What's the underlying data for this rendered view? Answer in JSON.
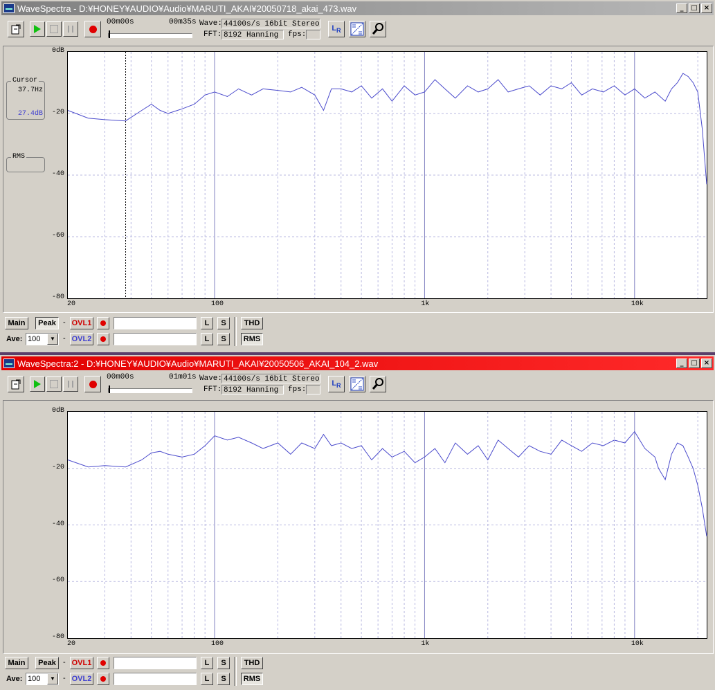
{
  "windows": [
    {
      "title": "WaveSpectra - D:¥HONEY¥AUDIO¥Audio¥MARUTI_AKAI¥20050718_akai_473.wav",
      "active": false,
      "time_start": "00m00s",
      "time_end": "00m35s",
      "position_fraction": 0.0,
      "wave_label": "Wave:",
      "wave_value": "44100s/s 16bit Stereo",
      "fft_label": "FFT:",
      "fft_value": "8192 Hanning",
      "fps_label": "fps:",
      "fps_value": "",
      "cursor_label": "Cursor",
      "cursor_freq": "37.7Hz",
      "cursor_db": "27.4dB",
      "cursor_hz": 37.7,
      "rms_label": "RMS",
      "bottom": {
        "main": "Main",
        "peak": "Peak",
        "ave_label": "Ave:",
        "ave_value": "100",
        "ovl1": "OVL1",
        "ovl2": "OVL2",
        "l": "L",
        "s": "S",
        "thd": "THD",
        "rms": "RMS",
        "dash": "-"
      }
    },
    {
      "title": "WaveSpectra:2 - D:¥HONEY¥AUDIO¥Audio¥MARUTI_AKAI¥20050506_AKAI_104_2.wav",
      "active": true,
      "time_start": "00m00s",
      "time_end": "01m01s",
      "position_fraction": 0.0,
      "wave_label": "Wave:",
      "wave_value": "44100s/s 16bit Stereo",
      "fft_label": "FFT:",
      "fft_value": "8192 Hanning",
      "fps_label": "fps:",
      "fps_value": "",
      "bottom": {
        "main": "Main",
        "peak": "Peak",
        "ave_label": "Ave:",
        "ave_value": "100",
        "ovl1": "OVL1",
        "ovl2": "OVL2",
        "l": "L",
        "s": "S",
        "thd": "THD",
        "rms": "RMS",
        "dash": "-"
      }
    }
  ],
  "colors": {
    "trace": "#4a4acc",
    "grid": "#b8b8e0",
    "title_active": "#e00000",
    "title_inactive": "#9a9a9a"
  },
  "chart_data": [
    {
      "type": "line",
      "xscale": "log",
      "xlim": [
        20,
        22050
      ],
      "ylim": [
        -80,
        0
      ],
      "xticks": [
        {
          "v": 20,
          "label": "20"
        },
        {
          "v": 100,
          "label": "100"
        },
        {
          "v": 1000,
          "label": "1k"
        },
        {
          "v": 10000,
          "label": "10k"
        }
      ],
      "yticks": [
        {
          "v": 0,
          "label": "0dB"
        },
        {
          "v": -20,
          "label": "-20"
        },
        {
          "v": -40,
          "label": "-40"
        },
        {
          "v": -60,
          "label": "-60"
        },
        {
          "v": -80,
          "label": "-80"
        }
      ],
      "grid": true,
      "series": [
        {
          "x": [
            20,
            25,
            30,
            37.7,
            45,
            50,
            55,
            60,
            70,
            80,
            90,
            100,
            115,
            130,
            150,
            170,
            200,
            230,
            260,
            300,
            330,
            360,
            400,
            450,
            500,
            560,
            630,
            700,
            800,
            900,
            1000,
            1120,
            1250,
            1400,
            1600,
            1800,
            2000,
            2240,
            2500,
            2800,
            3150,
            3550,
            4000,
            4500,
            5000,
            5600,
            6300,
            7100,
            8000,
            9000,
            10000,
            11200,
            12500,
            14000,
            15000,
            16000,
            17000,
            18000,
            19000,
            20000,
            21000,
            22050
          ],
          "y": [
            -19,
            -21.5,
            -22,
            -22.4,
            -19,
            -17,
            -19,
            -20,
            -18.5,
            -17,
            -14,
            -13,
            -14.5,
            -12,
            -14,
            -12,
            -12.5,
            -13,
            -11.5,
            -14,
            -19,
            -12,
            -12,
            -13,
            -11,
            -15,
            -12,
            -16,
            -11,
            -14,
            -13,
            -9,
            -12,
            -15,
            -11,
            -13,
            -12,
            -9,
            -13,
            -12,
            -11,
            -14,
            -11,
            -12,
            -10,
            -14,
            -12,
            -13,
            -11,
            -14,
            -12,
            -15,
            -13,
            -16,
            -12,
            -10,
            -7,
            -8,
            -10,
            -13,
            -25,
            -43
          ]
        }
      ]
    },
    {
      "type": "line",
      "xscale": "log",
      "xlim": [
        20,
        22050
      ],
      "ylim": [
        -80,
        0
      ],
      "xticks": [
        {
          "v": 20,
          "label": "20"
        },
        {
          "v": 100,
          "label": "100"
        },
        {
          "v": 1000,
          "label": "1k"
        },
        {
          "v": 10000,
          "label": "10k"
        }
      ],
      "yticks": [
        {
          "v": 0,
          "label": "0dB"
        },
        {
          "v": -20,
          "label": "-20"
        },
        {
          "v": -40,
          "label": "-40"
        },
        {
          "v": -60,
          "label": "-60"
        },
        {
          "v": -80,
          "label": "-80"
        }
      ],
      "grid": true,
      "series": [
        {
          "x": [
            20,
            25,
            30,
            37.7,
            45,
            50,
            55,
            60,
            70,
            80,
            90,
            100,
            115,
            130,
            150,
            170,
            200,
            230,
            260,
            300,
            330,
            360,
            400,
            450,
            500,
            560,
            630,
            700,
            800,
            900,
            1000,
            1120,
            1250,
            1400,
            1600,
            1800,
            2000,
            2240,
            2500,
            2800,
            3150,
            3550,
            4000,
            4500,
            5000,
            5600,
            6300,
            7100,
            8000,
            9000,
            10000,
            11200,
            12500,
            13000,
            14000,
            15000,
            16000,
            17000,
            18000,
            19000,
            20000,
            21000,
            22050
          ],
          "y": [
            -17,
            -19.5,
            -19,
            -19.5,
            -17,
            -14.5,
            -14,
            -15,
            -16,
            -15,
            -12,
            -8.5,
            -10,
            -9,
            -11,
            -13,
            -11,
            -15,
            -11,
            -13,
            -8,
            -12,
            -11,
            -13,
            -12,
            -17,
            -13,
            -16,
            -14,
            -18,
            -16,
            -13,
            -18,
            -11,
            -15,
            -12,
            -17,
            -10,
            -13,
            -16,
            -12,
            -14,
            -15,
            -10,
            -12,
            -14,
            -11,
            -12,
            -10,
            -11,
            -7,
            -13,
            -16,
            -20,
            -24,
            -15,
            -11,
            -12,
            -16,
            -20,
            -26,
            -34,
            -44
          ]
        }
      ]
    }
  ]
}
